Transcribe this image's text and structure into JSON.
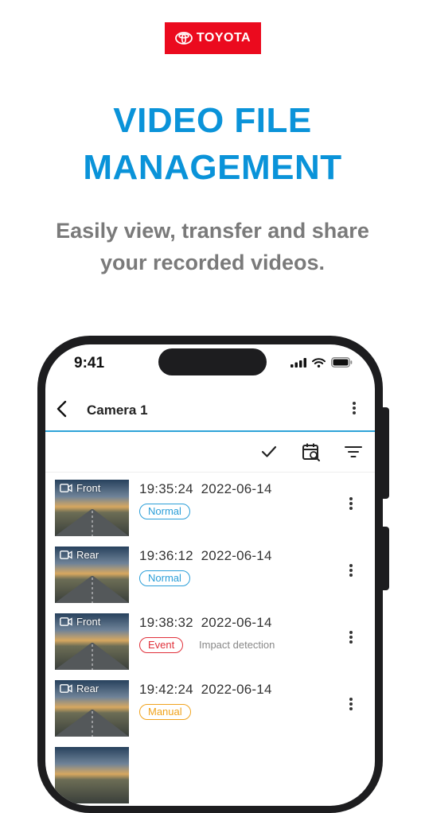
{
  "brand": {
    "name": "TOYOTA",
    "color": "#eb0a1e"
  },
  "headline": {
    "line1": "VIDEO FILE",
    "line2": "MANAGEMENT",
    "color": "#0a93d9"
  },
  "subhead": {
    "line1": "Easily view, transfer and share",
    "line2": "your recorded videos."
  },
  "status": {
    "time": "9:41",
    "icons": [
      "signal-icon",
      "wifi-icon",
      "battery-icon"
    ]
  },
  "appbar": {
    "title": "Camera 1"
  },
  "toolbar": {
    "icons": [
      "check-icon",
      "calendar-search-icon",
      "filter-icon"
    ]
  },
  "videos": [
    {
      "camera": "Front",
      "time": "19:35:24",
      "date": "2022-06-14",
      "type": "Normal",
      "type_color": "#2b9ed8",
      "note": ""
    },
    {
      "camera": "Rear",
      "time": "19:36:12",
      "date": "2022-06-14",
      "type": "Normal",
      "type_color": "#2b9ed8",
      "note": ""
    },
    {
      "camera": "Front",
      "time": "19:38:32",
      "date": "2022-06-14",
      "type": "Event",
      "type_color": "#e0313b",
      "note": "Impact detection"
    },
    {
      "camera": "Rear",
      "time": "19:42:24",
      "date": "2022-06-14",
      "type": "Manual",
      "type_color": "#f0a31e",
      "note": ""
    }
  ]
}
